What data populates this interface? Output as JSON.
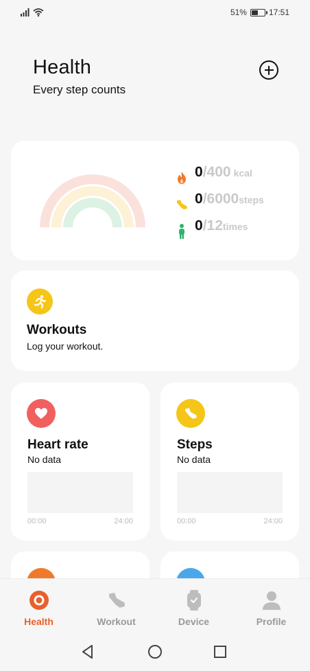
{
  "status_bar": {
    "battery": "51%",
    "battery_level": 0.51,
    "time": "17:51"
  },
  "header": {
    "title": "Health",
    "subtitle": "Every step counts"
  },
  "summary": {
    "calories": {
      "value": "0",
      "goal": "/400",
      "unit": "kcal"
    },
    "steps": {
      "value": "0",
      "goal": "/6000",
      "unit": "steps"
    },
    "stand": {
      "value": "0",
      "goal": "/12",
      "unit": "times"
    }
  },
  "workouts": {
    "title": "Workouts",
    "subtitle": "Log your workout."
  },
  "heart_rate": {
    "title": "Heart rate",
    "status": "No data",
    "axis_start": "00:00",
    "axis_end": "24:00"
  },
  "steps_card": {
    "title": "Steps",
    "status": "No data",
    "axis_start": "00:00",
    "axis_end": "24:00"
  },
  "bottom_nav": {
    "items": [
      {
        "label": "Health",
        "icon": "health-ring-icon",
        "active": true
      },
      {
        "label": "Workout",
        "icon": "shoe-icon",
        "active": false
      },
      {
        "label": "Device",
        "icon": "watch-icon",
        "active": false
      },
      {
        "label": "Profile",
        "icon": "person-icon",
        "active": false
      }
    ]
  },
  "colors": {
    "accent": "#e8602c",
    "calories": "#f07a2a",
    "steps": "#f5c518",
    "stand": "#2fb36b",
    "heart": "#f0605f",
    "sleep": "#4aa8e8"
  }
}
